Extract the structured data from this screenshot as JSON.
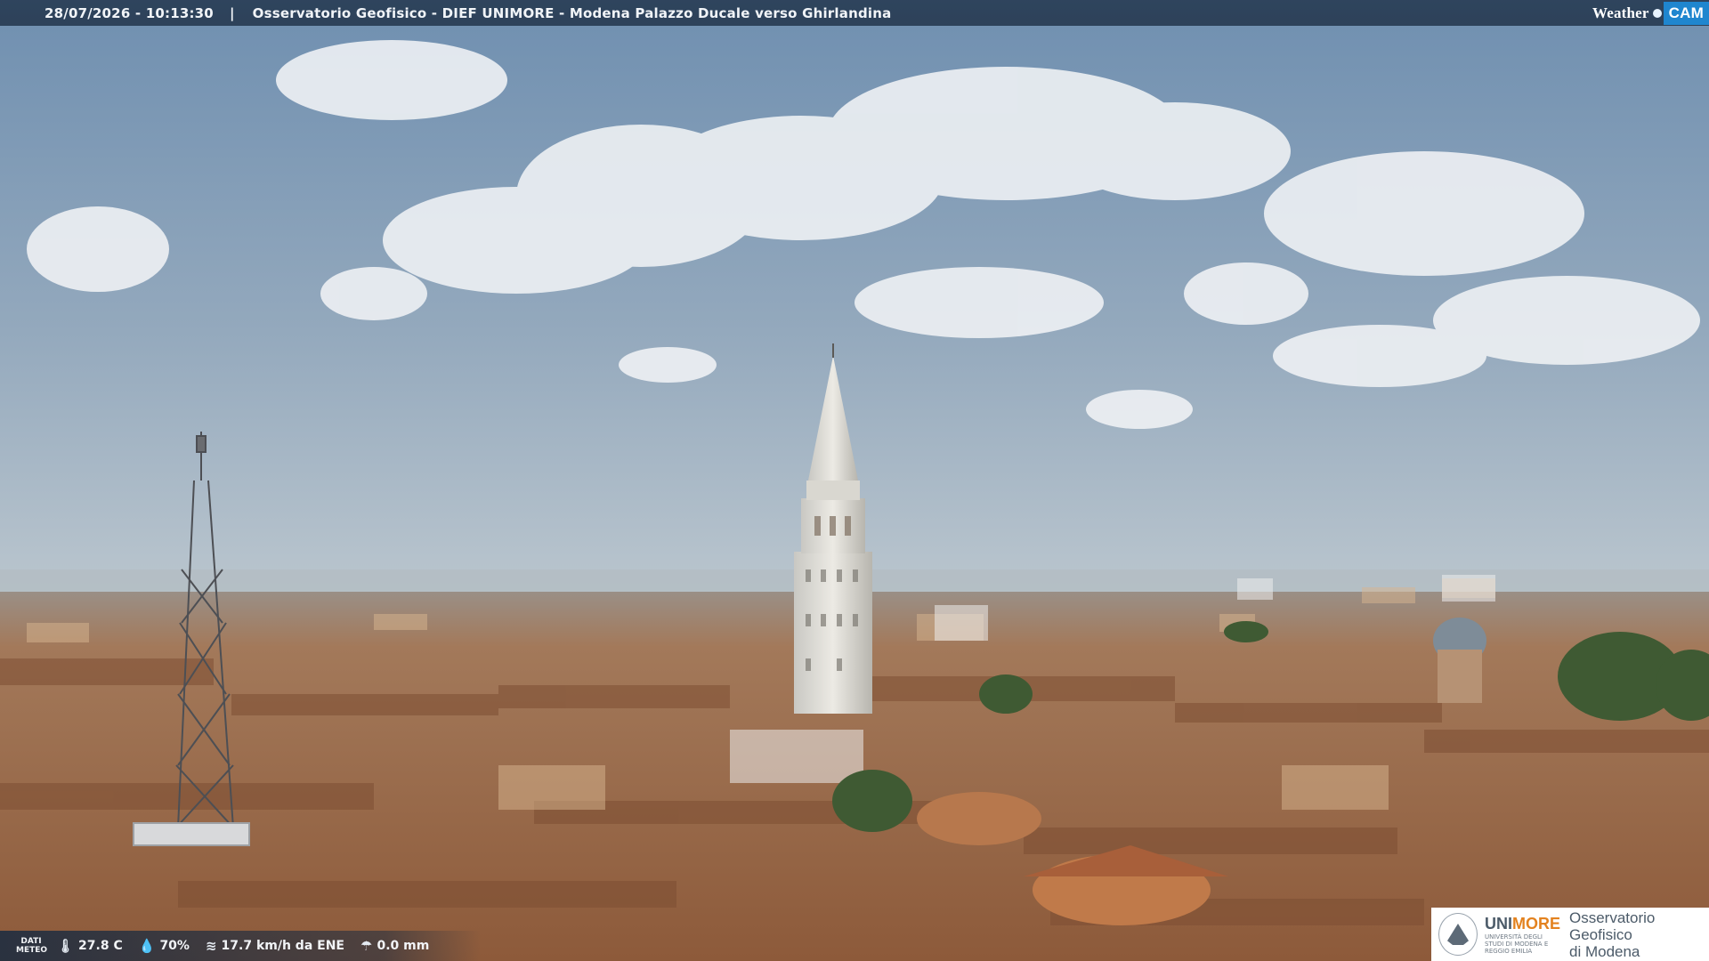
{
  "header": {
    "timestamp": "28/07/2026 - 10:13:30",
    "separator": "|",
    "caption": "Osservatorio Geofisico - DIEF UNIMORE - Modena Palazzo Ducale verso Ghirlandina"
  },
  "brand": {
    "word": "Weather",
    "cam": "CAM"
  },
  "meteo": {
    "label": "DATI METEO",
    "temperature": "27.8 C",
    "humidity": "70%",
    "wind": "17.7 km/h da ENE",
    "rain": "0.0 mm"
  },
  "logo": {
    "university_prefix": "UNI",
    "university_suffix": "MORE",
    "university_sub": "UNIVERSITÀ DEGLI STUDI DI MODENA E REGGIO EMILIA",
    "observatory_line1": "Osservatorio Geofisico",
    "observatory_line2": "di Modena"
  },
  "colors": {
    "sky_top": "#6f8fb0",
    "sky_horizon": "#b9c6cf",
    "roofs": "#a86f48",
    "cam_accent": "#1f86cf",
    "unimore_orange": "#e3821f"
  }
}
